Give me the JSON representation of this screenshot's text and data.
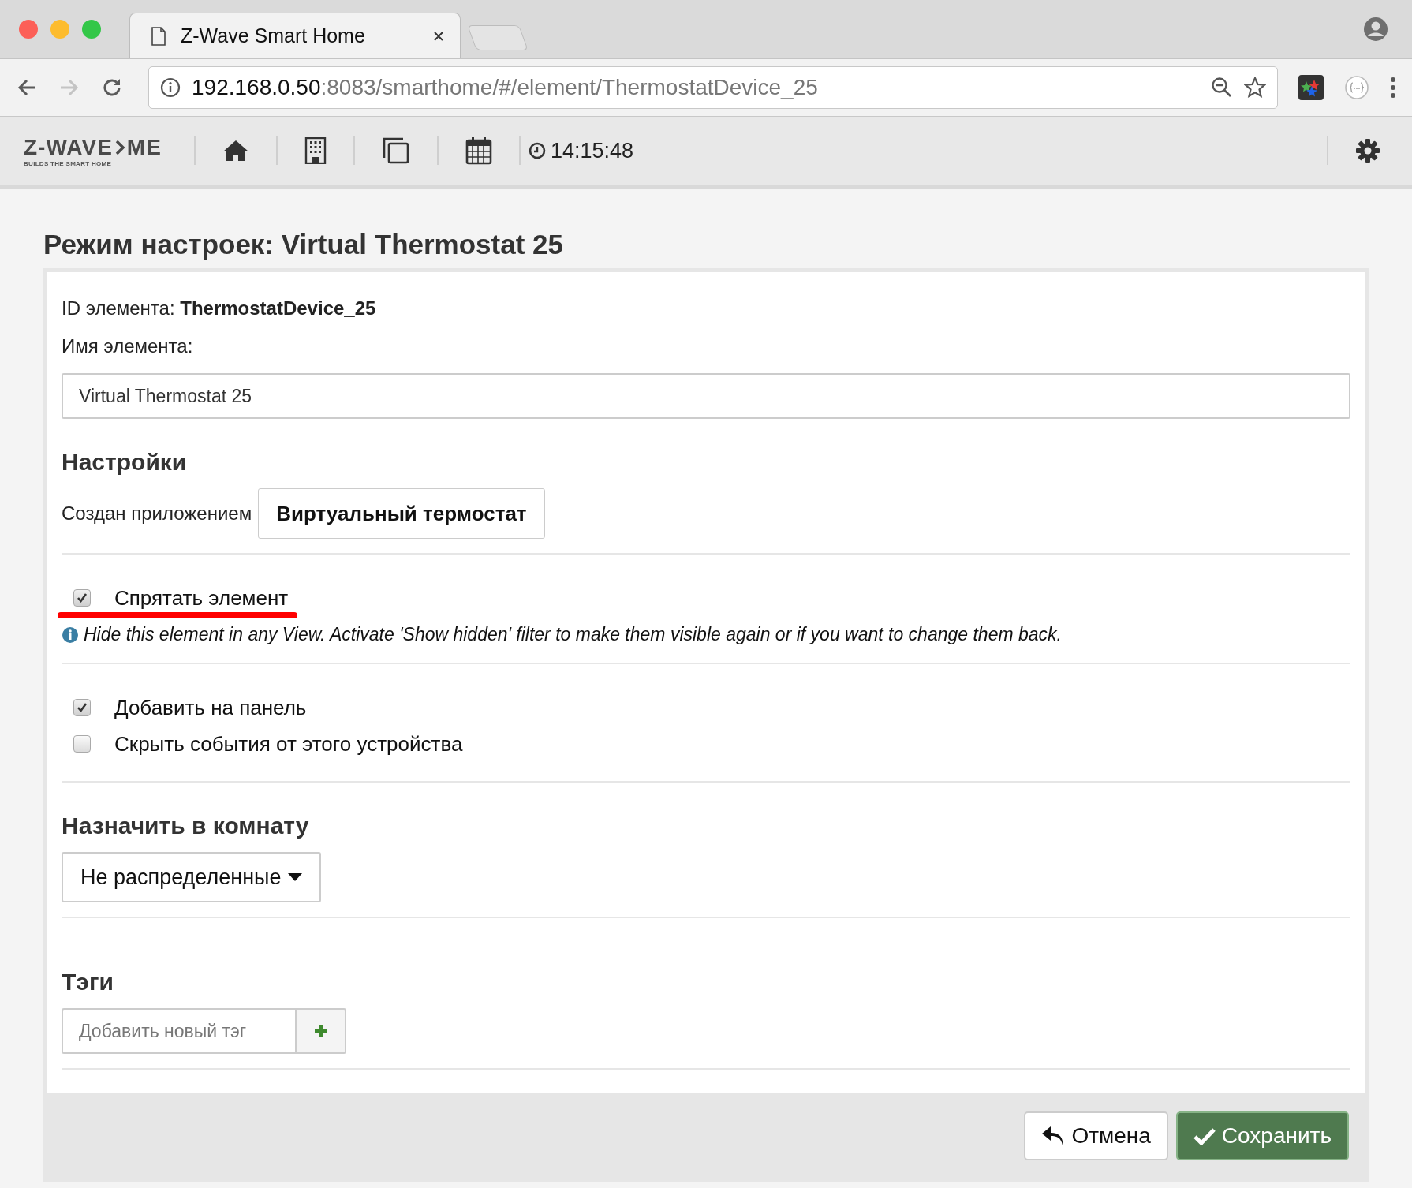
{
  "browser": {
    "tab_title": "Z-Wave Smart Home",
    "url_host": "192.168.0.50",
    "url_path": ":8083/smarthome/#/element/ThermostatDevice_25"
  },
  "nav": {
    "logo_left": "Z-WAVE",
    "logo_right": "ME",
    "logo_tagline": "BUILDS THE SMART HOME",
    "time": "14:15:48"
  },
  "title": "Режим настроек: Virtual Thermostat 25",
  "element_id": "ID элемента: **ThermostatDevice_25**",
  "name_field": {
    "label": "Имя элемента:",
    "value": "Virtual Thermostat 25"
  },
  "settings": {
    "heading": "Настройки",
    "created_by_label": "Создан приложением",
    "created_by_app": "Виртуальный термостат"
  },
  "hide_option": {
    "label": "Спрятать элемент",
    "checked": true,
    "hint": "Hide this element in any View. Activate 'Show hidden' filter to make them visible again or if you want to change them back."
  },
  "options": [
    {
      "label": "Добавить на панель",
      "checked": true
    },
    {
      "label": "Скрыть события от этого устройства",
      "checked": false
    }
  ],
  "room": {
    "heading": "Назначить в комнату",
    "value": "Не распределенные"
  },
  "tags": {
    "heading": "Тэги",
    "placeholder": "Добавить новый тэг"
  },
  "buttons": [
    {
      "kind": "cancel",
      "label": "Отмена"
    },
    {
      "kind": "save",
      "label": "Сохранить"
    }
  ]
}
